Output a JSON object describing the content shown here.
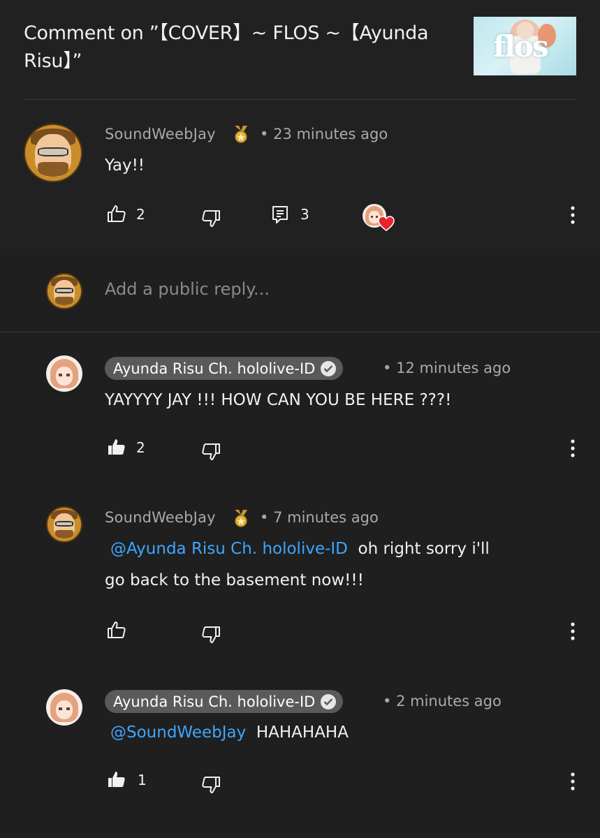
{
  "header": {
    "title": "Comment on ”【COVER】~ FLOS ~【Ayunda Risu】”",
    "thumbnail_icon": "video-thumbnail"
  },
  "main_comment": {
    "author": "SoundWeebJay",
    "separator": "•",
    "time": "23 minutes ago",
    "text": "Yay!!",
    "likes": "2",
    "replies": "3"
  },
  "reply_box": {
    "placeholder": "Add a public reply..."
  },
  "replies": [
    {
      "author": "Ayunda Risu Ch. hololive-ID",
      "time": "12 minutes ago",
      "text": "YAYYYY JAY !!! HOW CAN YOU BE HERE ???!",
      "likes": "2"
    },
    {
      "author": "SoundWeebJay",
      "time": "7 minutes ago",
      "mention": "@Ayunda Risu Ch. hololive-ID",
      "text_line1": "oh right sorry i'll",
      "text_line2": "go back to the basement now!!!"
    },
    {
      "author": "Ayunda Risu Ch. hololive-ID",
      "time": "2 minutes ago",
      "mention": "@SoundWeebJay",
      "text": "HAHAHAHA",
      "likes": "1"
    }
  ],
  "colors": {
    "background": "#212121",
    "mention": "#3ea6ff",
    "heart": "#e8232c",
    "medal": "#e8b43a"
  }
}
